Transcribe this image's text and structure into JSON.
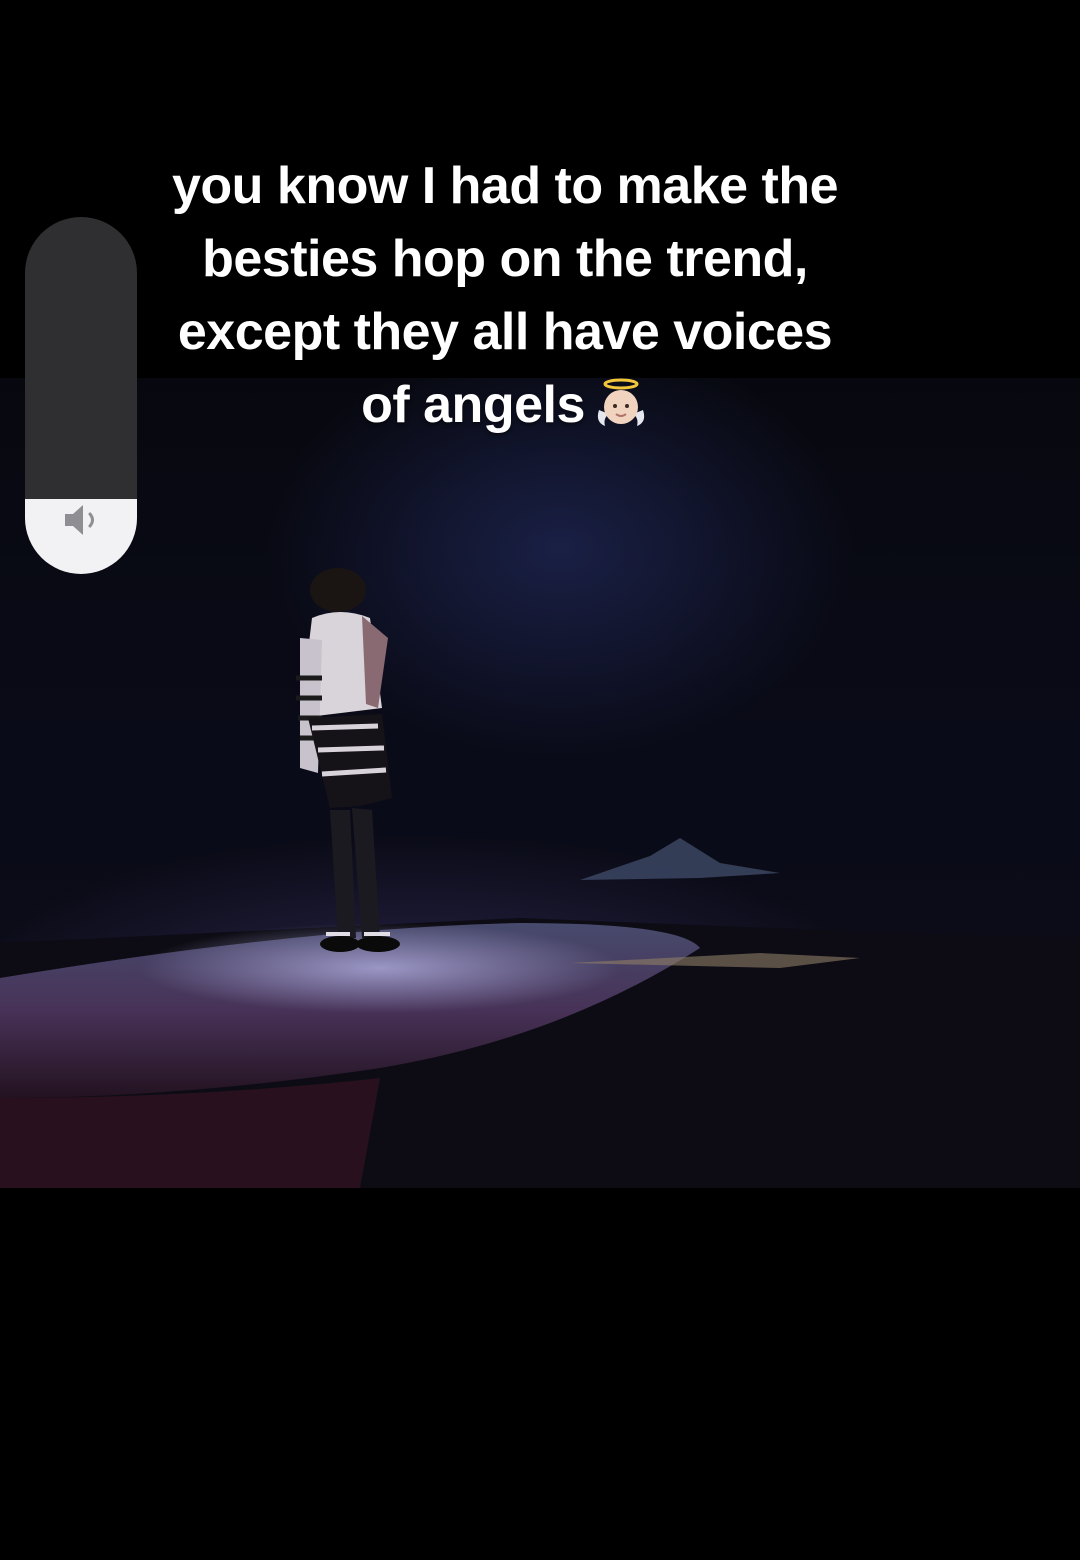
{
  "caption": {
    "lines": [
      "you know I had to make the",
      "besties hop on the trend,",
      "except they all have voices",
      "of angels"
    ],
    "emoji": "baby-angel-emoji"
  },
  "volume": {
    "level": 0.21,
    "icon": "speaker-low-icon"
  },
  "video": {
    "scene": "performer-on-stage"
  }
}
